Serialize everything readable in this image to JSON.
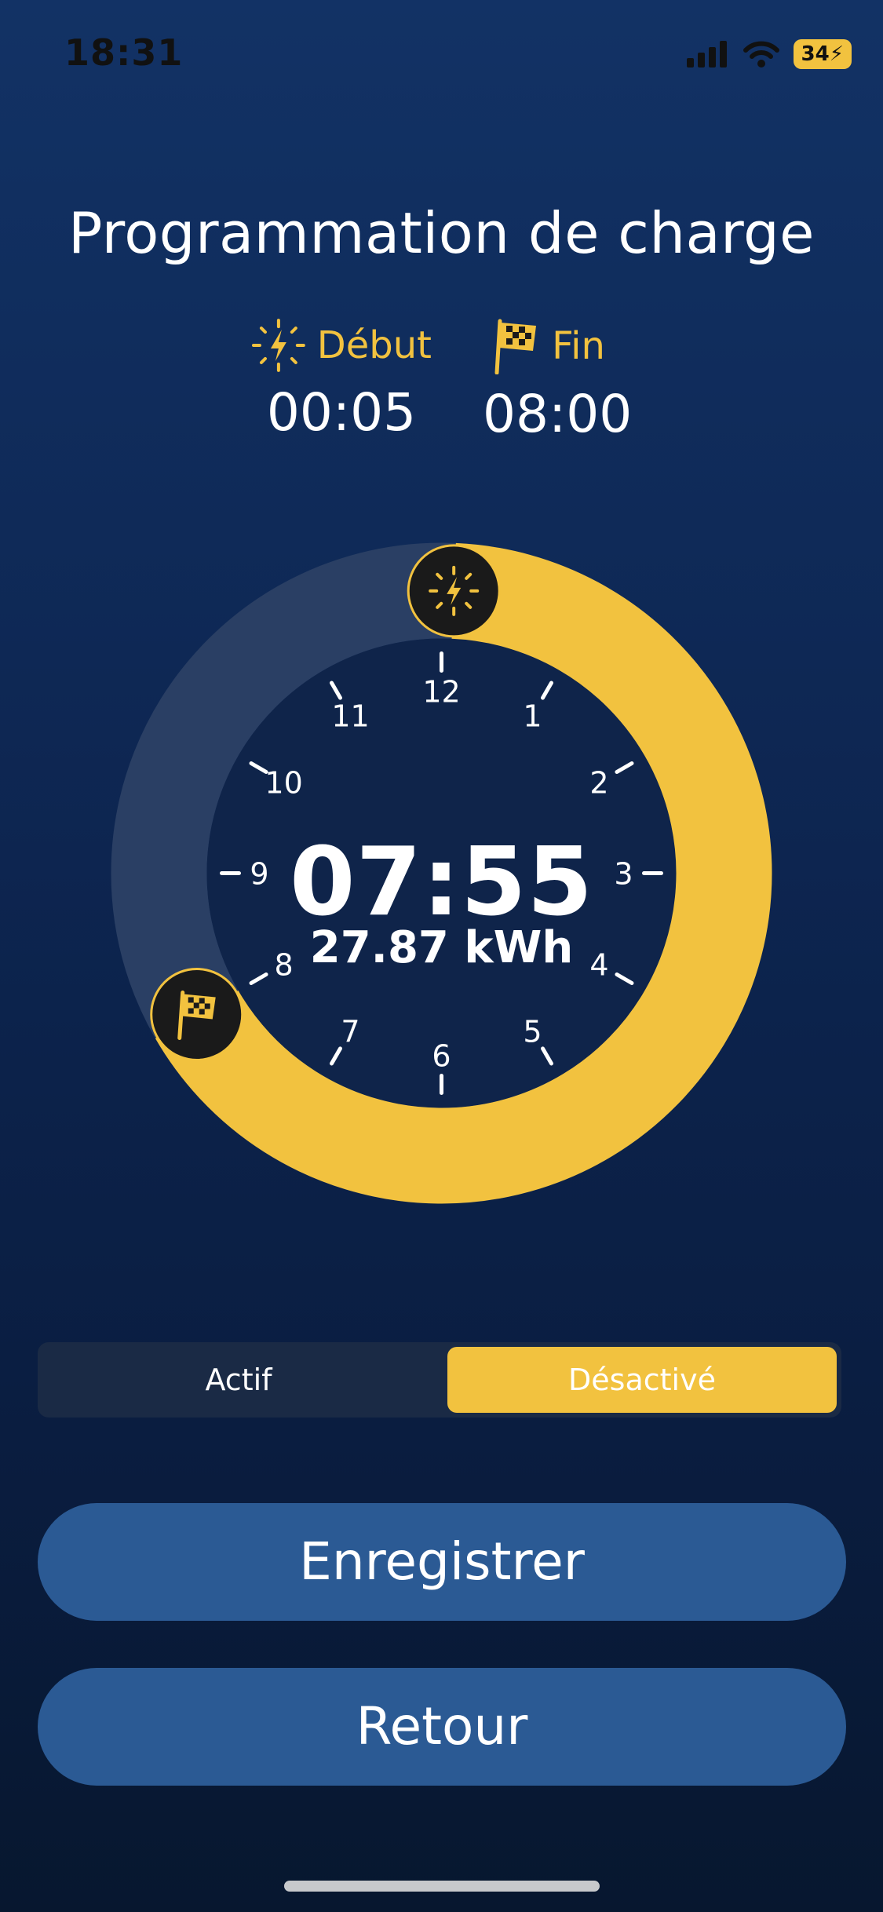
{
  "status_bar": {
    "time": "18:31",
    "battery": "34"
  },
  "screen": {
    "title": "Programmation de charge"
  },
  "schedule": {
    "start_label": "Début",
    "start_time": "00:05",
    "end_label": "Fin",
    "end_time": "08:00"
  },
  "clock": {
    "duration": "07:55",
    "energy": "27.87 kWh",
    "hours": [
      "12",
      "1",
      "2",
      "3",
      "4",
      "5",
      "6",
      "7",
      "8",
      "9",
      "10",
      "11"
    ],
    "start_hour": 0.0833,
    "end_hour": 8.0
  },
  "toggle": {
    "active_label": "Actif",
    "inactive_label": "Désactivé",
    "selected": "Désactivé"
  },
  "buttons": {
    "save": "Enregistrer",
    "back": "Retour"
  },
  "colors": {
    "accent": "#f2c23f",
    "button": "#2b5a94",
    "background": "#0d2550",
    "track": "#2a3f64"
  },
  "icons": {
    "start": "sun-bolt-icon",
    "end": "checkered-flag-icon"
  }
}
